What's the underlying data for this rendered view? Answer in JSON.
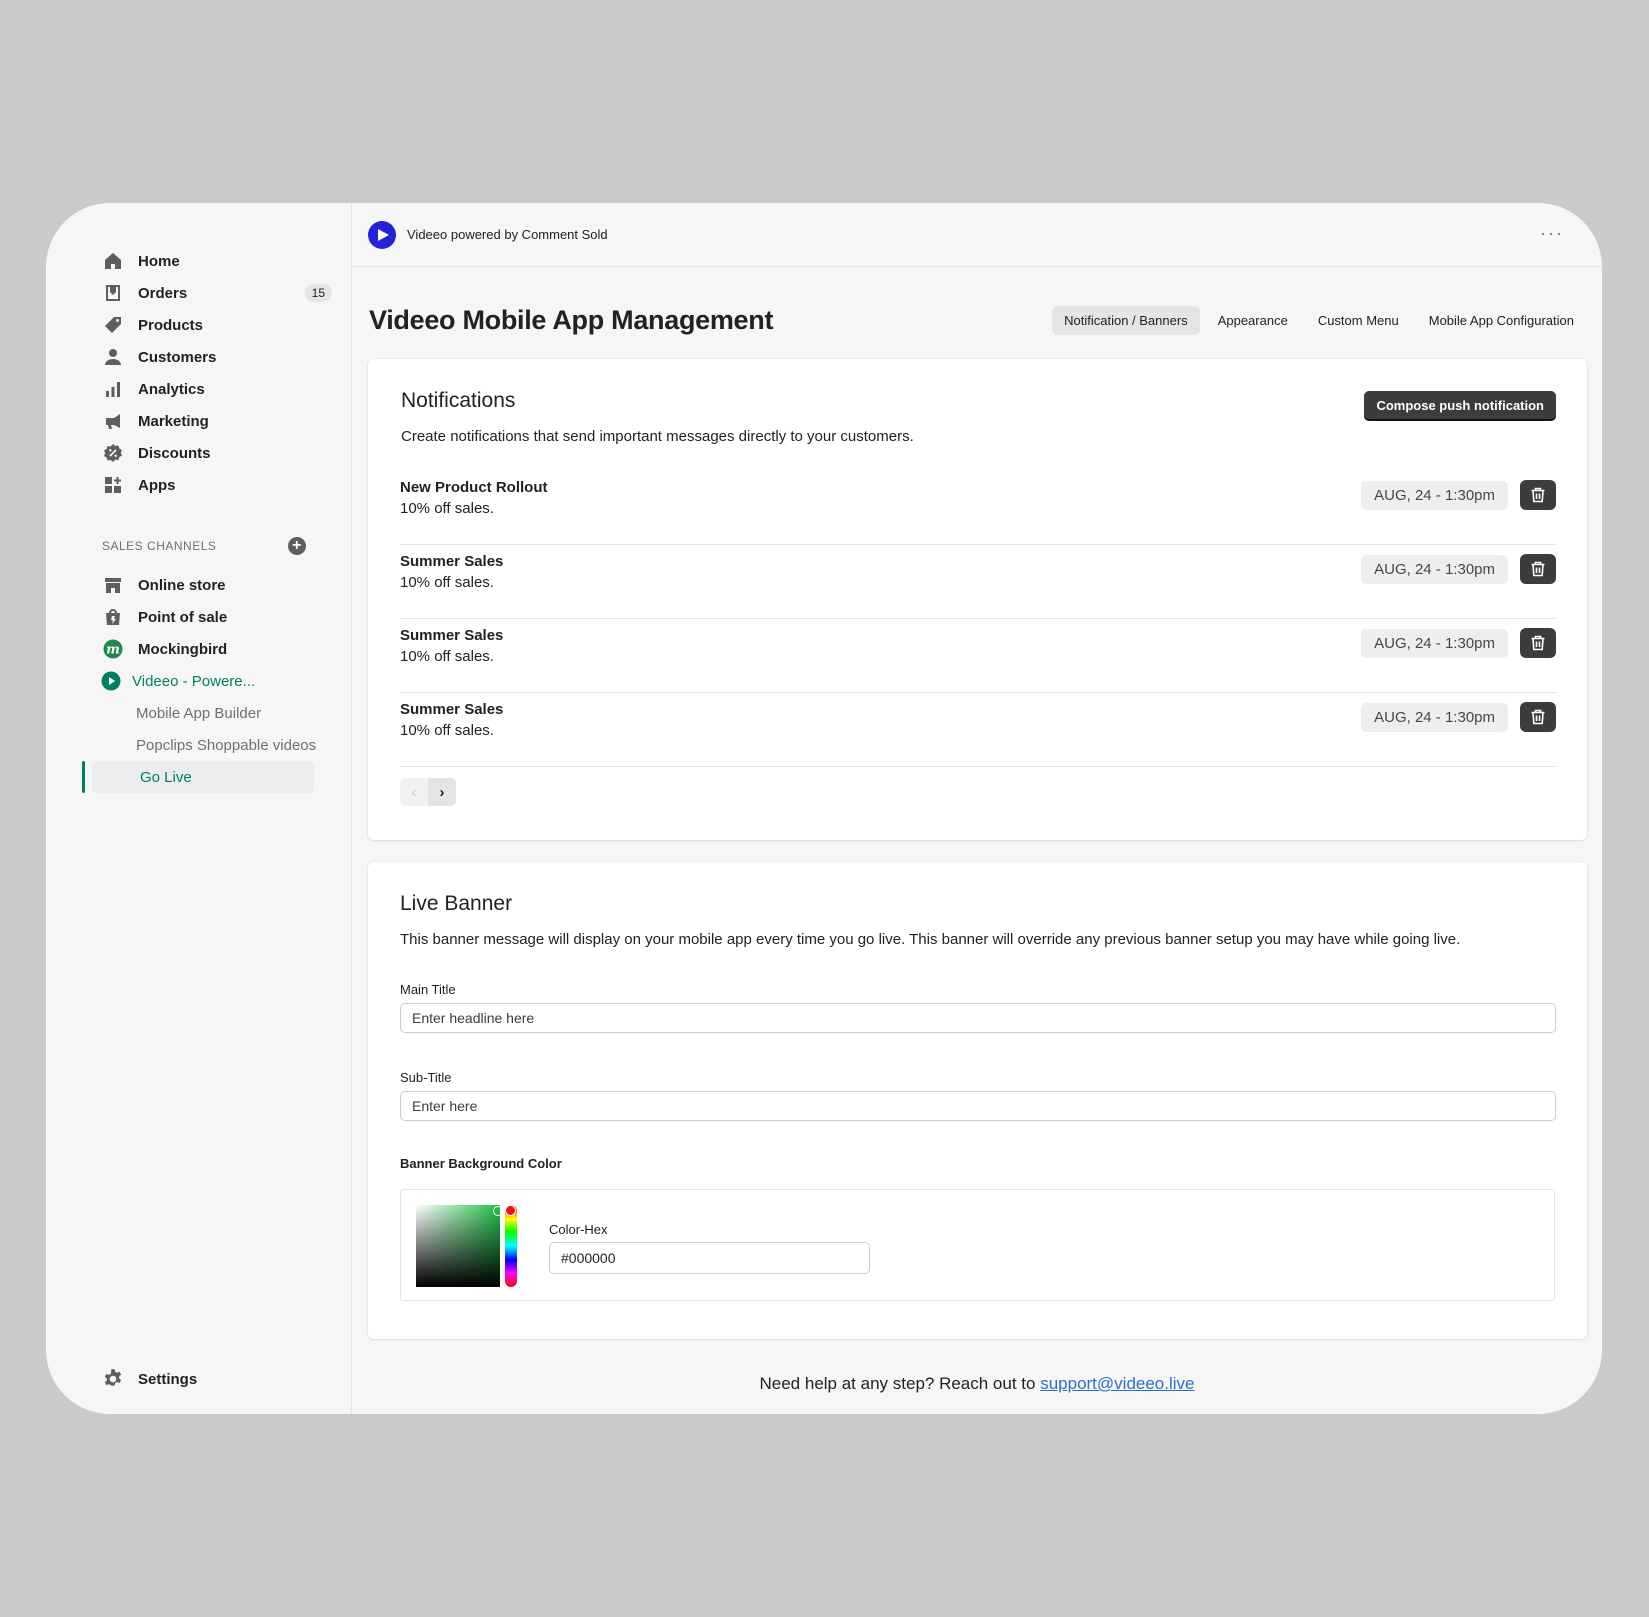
{
  "sidebar": {
    "nav": [
      {
        "label": "Home",
        "icon": "home-icon"
      },
      {
        "label": "Orders",
        "icon": "orders-icon",
        "badge": "15"
      },
      {
        "label": "Products",
        "icon": "tag-icon"
      },
      {
        "label": "Customers",
        "icon": "person-icon"
      },
      {
        "label": "Analytics",
        "icon": "bar-chart-icon"
      },
      {
        "label": "Marketing",
        "icon": "megaphone-icon"
      },
      {
        "label": "Discounts",
        "icon": "discount-icon"
      },
      {
        "label": "Apps",
        "icon": "apps-icon"
      }
    ],
    "sales_channels_heading": "SALES CHANNELS",
    "channels": [
      {
        "label": "Online store",
        "icon": "store-icon"
      },
      {
        "label": "Point of sale",
        "icon": "shopping-bag-icon"
      },
      {
        "label": "Mockingbird",
        "icon": "mockingbird-logo-icon"
      },
      {
        "label": "Videeo - Powere...",
        "icon": "play-circle-icon"
      }
    ],
    "sub_items": [
      "Mobile App Builder",
      "Popclips Shoppable videos",
      "Go Live"
    ],
    "settings_label": "Settings"
  },
  "topbar": {
    "app_name": "Videeo powered by Comment Sold",
    "more": "···"
  },
  "page": {
    "title": "Videeo Mobile App Management",
    "tabs": [
      "Notification / Banners",
      "Appearance",
      "Custom Menu",
      "Mobile App Configuration"
    ],
    "active_tab": "Notification / Banners"
  },
  "notifications": {
    "title": "Notifications",
    "description": "Create notifications that send important messages directly to your customers.",
    "compose_label": "Compose push notification",
    "items": [
      {
        "title": "New Product Rollout",
        "body": "10% off sales.",
        "date": "AUG, 24 - 1:30pm"
      },
      {
        "title": "Summer Sales",
        "body": "10% off sales.",
        "date": "AUG, 24 - 1:30pm"
      },
      {
        "title": "Summer Sales",
        "body": "10% off sales.",
        "date": "AUG, 24 - 1:30pm"
      },
      {
        "title": "Summer Sales",
        "body": "10% off sales.",
        "date": "AUG, 24 - 1:30pm"
      }
    ],
    "pager": {
      "prev": "‹",
      "next": "›"
    }
  },
  "live_banner": {
    "title": "Live Banner",
    "description": "This banner message will display on your mobile app every time you go live.  This banner will override any previous banner setup you may have while going live.",
    "main_title_label": "Main Title",
    "main_title_placeholder": "Enter headline here",
    "sub_title_label": "Sub-Title",
    "sub_title_placeholder": "Enter here",
    "bg_color_label": "Banner Background Color",
    "color_hex_label": "Color-Hex",
    "color_hex_value": "#000000"
  },
  "help": {
    "text": "Need help at any step? Reach out to ",
    "email": "support@videeo.live"
  },
  "colors": {
    "accent_green": "#008060",
    "logo_blue": "#2323d6",
    "dark_button": "#3b3c3e",
    "link": "#2c6ecb"
  }
}
